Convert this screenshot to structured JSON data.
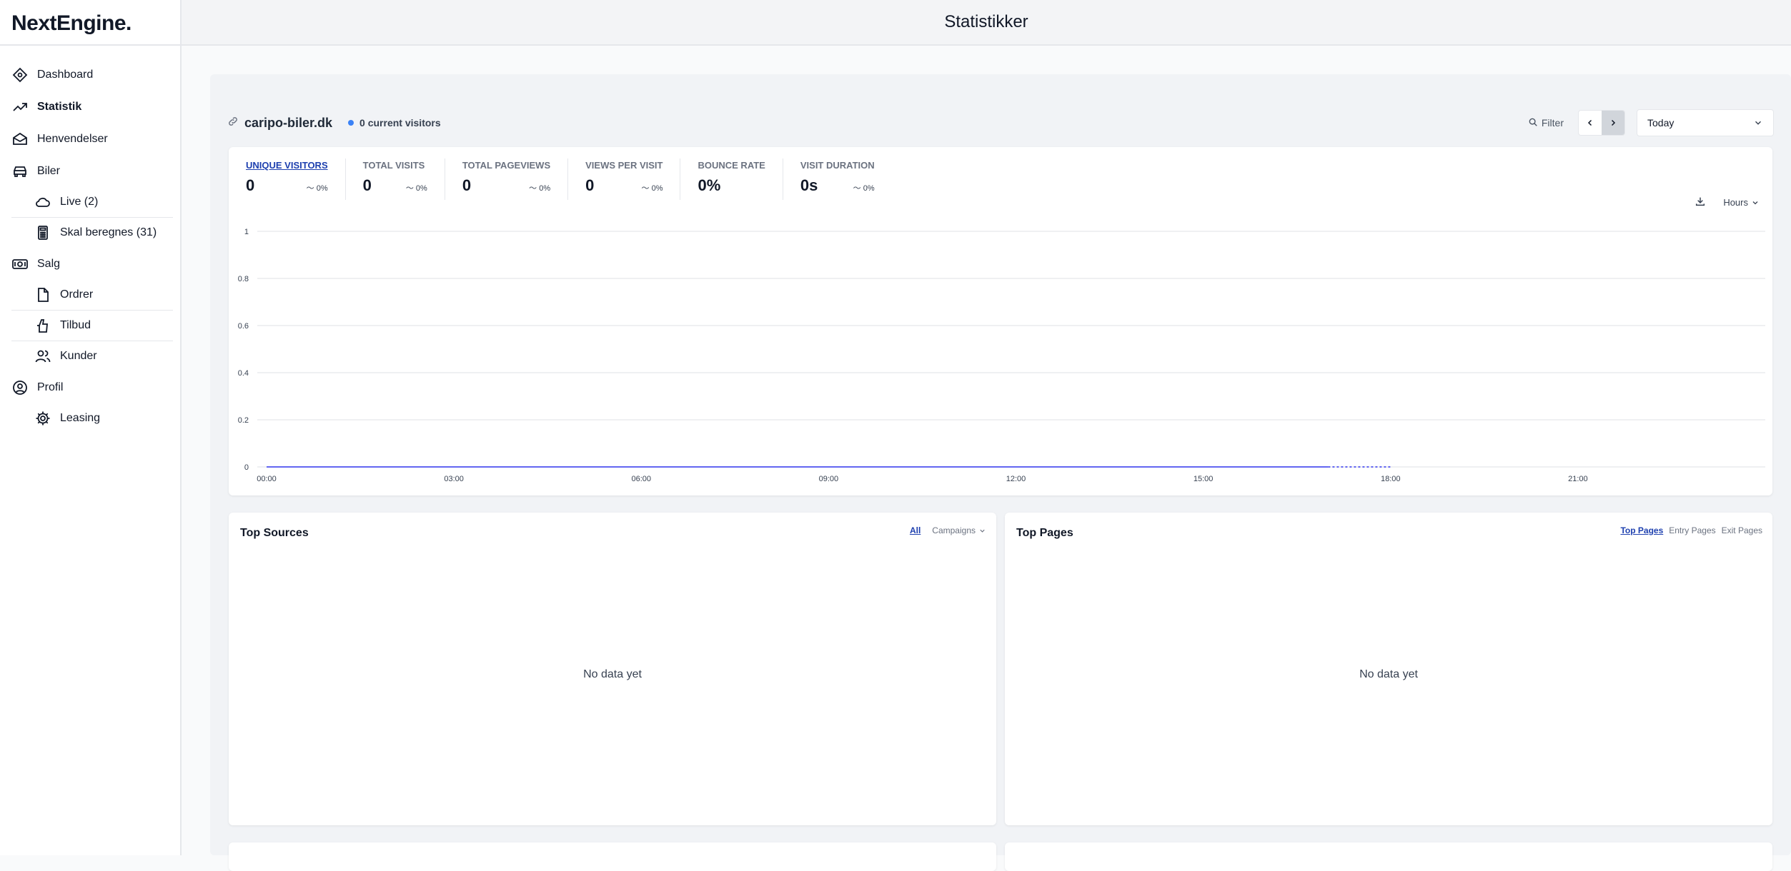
{
  "app": {
    "logo": "NextEngine.",
    "page_title": "Statistikker"
  },
  "sidebar": {
    "items": [
      {
        "label": "Dashboard",
        "icon": "diamond-icon"
      },
      {
        "label": "Statistik",
        "icon": "trending-up-icon",
        "active": true
      },
      {
        "label": "Henvendelser",
        "icon": "envelope-icon"
      },
      {
        "label": "Biler",
        "icon": "car-icon"
      },
      {
        "label": "Live (2)",
        "icon": "cloud-icon",
        "sub": true
      },
      {
        "label": "Skal beregnes (31)",
        "icon": "calculator-icon",
        "sub": true
      },
      {
        "label": "Salg",
        "icon": "cash-icon"
      },
      {
        "label": "Ordrer",
        "icon": "document-icon",
        "sub": true
      },
      {
        "label": "Tilbud",
        "icon": "hand-coin-icon",
        "sub": true
      },
      {
        "label": "Kunder",
        "icon": "users-icon",
        "sub": true
      },
      {
        "label": "Profil",
        "icon": "user-circle-icon"
      },
      {
        "label": "Leasing",
        "icon": "gear-icon",
        "sub": true
      }
    ]
  },
  "site": {
    "domain": "caripo-biler.dk",
    "current_visitors": "0 current visitors"
  },
  "controls": {
    "filter": "Filter",
    "period": "Today",
    "interval": "Hours"
  },
  "stats": [
    {
      "label": "UNIQUE VISITORS",
      "value": "0",
      "change": "〜 0%"
    },
    {
      "label": "TOTAL VISITS",
      "value": "0",
      "change": "〜 0%"
    },
    {
      "label": "TOTAL PAGEVIEWS",
      "value": "0",
      "change": "〜 0%"
    },
    {
      "label": "VIEWS PER VISIT",
      "value": "0",
      "change": "〜 0%"
    },
    {
      "label": "BOUNCE RATE",
      "value": "0%",
      "change": ""
    },
    {
      "label": "VISIT DURATION",
      "value": "0s",
      "change": "〜 0%"
    }
  ],
  "chart_data": {
    "type": "line",
    "x_ticks": [
      "00:00",
      "03:00",
      "06:00",
      "09:00",
      "12:00",
      "15:00",
      "18:00",
      "21:00"
    ],
    "y_ticks": [
      "1",
      "0.8",
      "0.6",
      "0.4",
      "0.2",
      "0"
    ],
    "ylim": [
      0,
      1
    ],
    "series": [
      {
        "values": [
          0,
          0,
          0,
          0,
          0,
          0,
          0,
          0,
          0,
          0,
          0,
          0,
          0,
          0,
          0,
          0,
          0,
          0,
          0,
          0,
          0,
          0,
          0,
          0
        ]
      }
    ],
    "current_hour": 17,
    "grid": true,
    "line_color": "#6366f1"
  },
  "sources": {
    "title": "Top Sources",
    "tabs": [
      "All",
      "Campaigns"
    ],
    "empty": "No data yet"
  },
  "pages": {
    "title": "Top Pages",
    "tabs": [
      "Top Pages",
      "Entry Pages",
      "Exit Pages"
    ],
    "empty": "No data yet"
  }
}
